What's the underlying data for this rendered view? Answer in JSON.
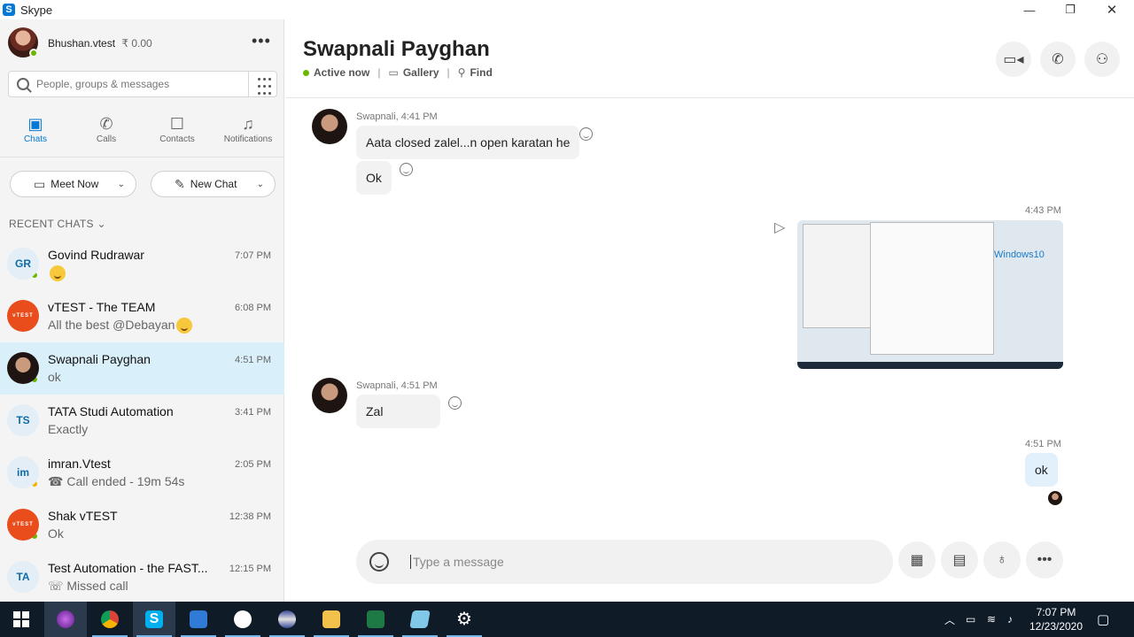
{
  "window": {
    "title": "Skype"
  },
  "profile": {
    "name": "Bhushan.vtest",
    "credit": "₹ 0.00"
  },
  "search": {
    "placeholder": "People, groups & messages"
  },
  "nav": {
    "chats": "Chats",
    "calls": "Calls",
    "contacts": "Contacts",
    "notifications": "Notifications"
  },
  "actions": {
    "meet_now": "Meet Now",
    "new_chat": "New Chat"
  },
  "recent_label": "RECENT CHATS",
  "chats": [
    {
      "initials": "GR",
      "name": "Govind Rudrawar",
      "time": "7:07 PM",
      "preview": "",
      "avatar": "initials",
      "presence": "online",
      "preview_emoji": true
    },
    {
      "initials": "vTEST",
      "name": "vTEST - The TEAM",
      "time": "6:08 PM",
      "preview": "All the best @Debayan",
      "avatar": "vtest",
      "presence": "none",
      "preview_emoji": true
    },
    {
      "initials": "",
      "name": "Swapnali Payghan",
      "time": "4:51 PM",
      "preview": "ok",
      "avatar": "photo",
      "presence": "online",
      "selected": true
    },
    {
      "initials": "TS",
      "name": "TATA Studi Automation",
      "time": "3:41 PM",
      "preview": "Exactly",
      "avatar": "initials",
      "presence": "none"
    },
    {
      "initials": "im",
      "name": "imran.Vtest",
      "time": "2:05 PM",
      "preview": "☎ Call ended - 19m 54s",
      "avatar": "initials",
      "presence": "away"
    },
    {
      "initials": "vTEST",
      "name": "Shak vTEST",
      "time": "12:38 PM",
      "preview": "Ok",
      "avatar": "vtest",
      "presence": "online"
    },
    {
      "initials": "TA",
      "name": "Test Automation - the FAST...",
      "time": "12:15 PM",
      "preview": "☏ Missed call",
      "avatar": "initials",
      "presence": "none"
    }
  ],
  "conversation": {
    "name": "Swapnali Payghan",
    "status": "Active now",
    "gallery": "Gallery",
    "find": "Find",
    "messages": {
      "m1_meta": "Swapnali, 4:41 PM",
      "m1_text": "Aata closed zalel...n open karatan he",
      "m2_text": "Ok",
      "img_time": "4:43 PM",
      "img_label": "Windows10",
      "m3_meta": "Swapnali, 4:51 PM",
      "m3_text": "Zal",
      "m4_time": "4:51 PM",
      "m4_text": "ok"
    },
    "compose_placeholder": "Type a message"
  },
  "taskbar": {
    "time": "7:07 PM",
    "date": "12/23/2020"
  },
  "colors": {
    "accent": "#0078d4",
    "online": "#6bb700",
    "away": "#f0b400",
    "selected_row": "#d9f0fb",
    "taskbar": "#101b28"
  }
}
